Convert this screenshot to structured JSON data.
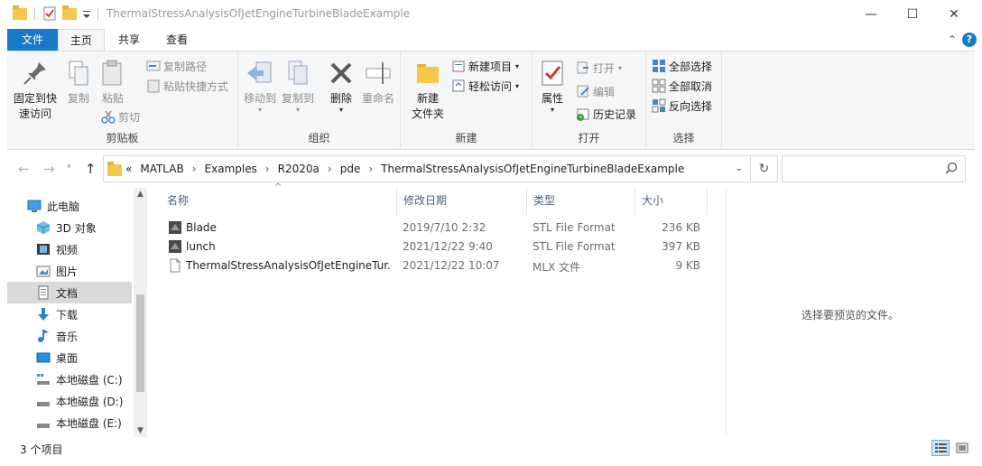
{
  "window": {
    "title": "ThermalStressAnalysisOfJetEngineTurbineBladeExample",
    "minimize": "—",
    "maximize": "☐",
    "close": "✕"
  },
  "tabs": [
    "文件",
    "主页",
    "共享",
    "查看"
  ],
  "ribbon": {
    "clipboard": {
      "label": "剪贴板",
      "pin": "固定到快\n速访问",
      "pin_l1": "固定到快",
      "pin_l2": "速访问",
      "copy": "复制",
      "paste": "粘贴",
      "copy_path": "复制路径",
      "paste_shortcut": "粘贴快捷方式",
      "cut": "剪切"
    },
    "organize": {
      "label": "组织",
      "move_to": "移动到",
      "copy_to": "复制到",
      "delete": "删除",
      "rename": "重命名"
    },
    "new": {
      "label": "新建",
      "new_folder_l1": "新建",
      "new_folder_l2": "文件夹",
      "new_item": "新建项目",
      "easy_access": "轻松访问"
    },
    "open": {
      "label": "打开",
      "properties": "属性",
      "open": "打开",
      "edit": "编辑",
      "history": "历史记录"
    },
    "select": {
      "label": "选择",
      "select_all": "全部选择",
      "select_none": "全部取消",
      "invert": "反向选择"
    }
  },
  "address": {
    "crumbs": [
      "«",
      "MATLAB",
      "›",
      "Examples",
      "›",
      "R2020a",
      "›",
      "pde",
      "›",
      "ThermalStressAnalysisOfJetEngineTurbineBladeExample"
    ]
  },
  "nav": {
    "items": [
      {
        "label": "此电脑"
      },
      {
        "label": "3D 对象"
      },
      {
        "label": "视频"
      },
      {
        "label": "图片"
      },
      {
        "label": "文档"
      },
      {
        "label": "下载"
      },
      {
        "label": "音乐"
      },
      {
        "label": "桌面"
      },
      {
        "label": "本地磁盘 (C:)"
      },
      {
        "label": "本地磁盘 (D:)"
      },
      {
        "label": "本地磁盘 (E:)"
      }
    ]
  },
  "columns": {
    "name": "名称",
    "date": "修改日期",
    "type": "类型",
    "size": "大小"
  },
  "files": [
    {
      "name": "Blade",
      "date": "2019/7/10 2:32",
      "type": "STL File Format",
      "size": "236 KB"
    },
    {
      "name": "lunch",
      "date": "2021/12/22 9:40",
      "type": "STL File Format",
      "size": "397 KB"
    },
    {
      "name": "ThermalStressAnalysisOfJetEngineTur...",
      "date": "2021/12/22 10:07",
      "type": "MLX 文件",
      "size": "9 KB"
    }
  ],
  "preview": {
    "message": "选择要预览的文件。"
  },
  "status": {
    "count": "3 个项目"
  },
  "colors": {
    "accent": "#1979ca",
    "folder": "#f4c84a"
  }
}
